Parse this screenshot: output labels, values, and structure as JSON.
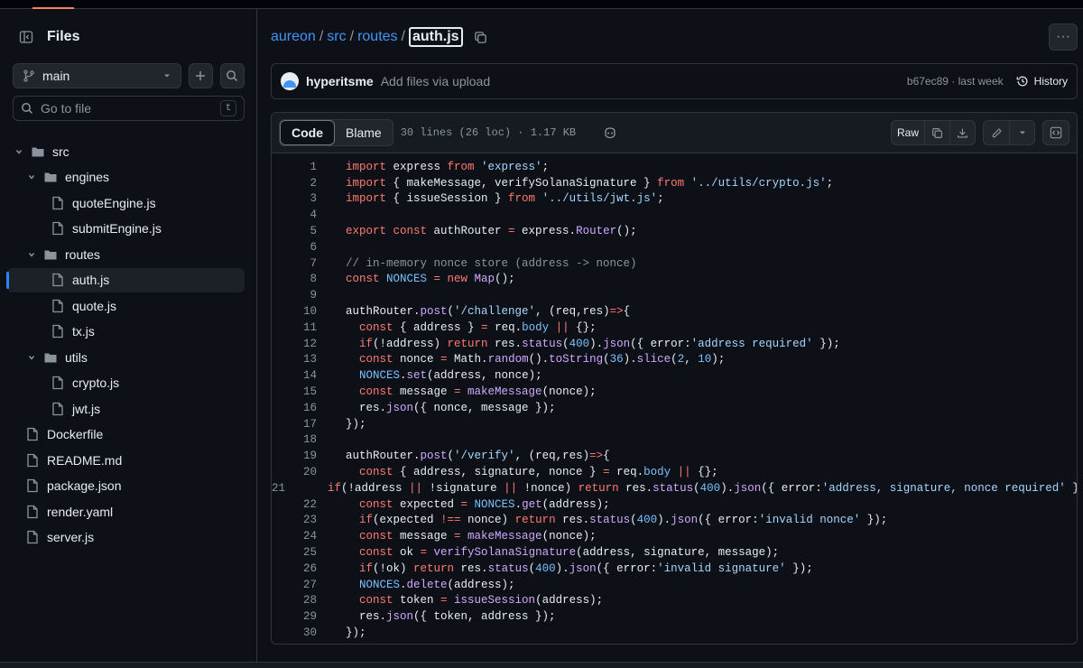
{
  "sidebar": {
    "title": "Files",
    "branch": "main",
    "search_placeholder": "Go to file",
    "search_shortcut": "t",
    "tree": [
      {
        "label": "src",
        "type": "folder",
        "depth": 0,
        "expanded": true
      },
      {
        "label": "engines",
        "type": "folder",
        "depth": 1,
        "expanded": true
      },
      {
        "label": "quoteEngine.js",
        "type": "file",
        "depth": 2
      },
      {
        "label": "submitEngine.js",
        "type": "file",
        "depth": 2
      },
      {
        "label": "routes",
        "type": "folder",
        "depth": 1,
        "expanded": true
      },
      {
        "label": "auth.js",
        "type": "file",
        "depth": 2,
        "selected": true
      },
      {
        "label": "quote.js",
        "type": "file",
        "depth": 2
      },
      {
        "label": "tx.js",
        "type": "file",
        "depth": 2
      },
      {
        "label": "utils",
        "type": "folder",
        "depth": 1,
        "expanded": true
      },
      {
        "label": "crypto.js",
        "type": "file",
        "depth": 2
      },
      {
        "label": "jwt.js",
        "type": "file",
        "depth": 2
      },
      {
        "label": "Dockerfile",
        "type": "file",
        "depth": 0
      },
      {
        "label": "README.md",
        "type": "file",
        "depth": 0
      },
      {
        "label": "package.json",
        "type": "file",
        "depth": 0
      },
      {
        "label": "render.yaml",
        "type": "file",
        "depth": 0
      },
      {
        "label": "server.js",
        "type": "file",
        "depth": 0
      }
    ]
  },
  "breadcrumb": {
    "parts": [
      "aureon",
      "src",
      "routes"
    ],
    "current": "auth.js"
  },
  "commit": {
    "user": "hyperitsme",
    "message": "Add files via upload",
    "sha_time": "b67ec89 · last week",
    "history_label": "History"
  },
  "toolbar": {
    "code_tab": "Code",
    "blame_tab": "Blame",
    "lines_info": "30 lines (26 loc) · 1.17 KB",
    "raw_label": "Raw"
  },
  "code": [
    [
      [
        "k",
        "import"
      ],
      [
        "t",
        " express "
      ],
      [
        "k",
        "from"
      ],
      [
        "s",
        " 'express'"
      ],
      [
        "t",
        ";"
      ]
    ],
    [
      [
        "k",
        "import"
      ],
      [
        "t",
        " { makeMessage, verifySolanaSignature } "
      ],
      [
        "k",
        "from"
      ],
      [
        "s",
        " '../utils/crypto.js'"
      ],
      [
        "t",
        ";"
      ]
    ],
    [
      [
        "k",
        "import"
      ],
      [
        "t",
        " { issueSession } "
      ],
      [
        "k",
        "from"
      ],
      [
        "s",
        " '../utils/jwt.js'"
      ],
      [
        "t",
        ";"
      ]
    ],
    [],
    [
      [
        "k",
        "export const"
      ],
      [
        "t",
        " authRouter "
      ],
      [
        "k",
        "="
      ],
      [
        "t",
        " express."
      ],
      [
        "f",
        "Router"
      ],
      [
        "t",
        "();"
      ]
    ],
    [],
    [
      [
        "c",
        "// in-memory nonce store (address -> nonce)"
      ]
    ],
    [
      [
        "k",
        "const"
      ],
      [
        "n",
        " NONCES"
      ],
      [
        "k",
        " = new"
      ],
      [
        "f",
        " Map"
      ],
      [
        "t",
        "();"
      ]
    ],
    [],
    [
      [
        "t",
        "authRouter."
      ],
      [
        "f",
        "post"
      ],
      [
        "t",
        "("
      ],
      [
        "s",
        "'/challenge'"
      ],
      [
        "t",
        ", (req,res)"
      ],
      [
        "k",
        "=>"
      ],
      [
        "t",
        "{"
      ]
    ],
    [
      [
        "k",
        "  const"
      ],
      [
        "t",
        " { address } "
      ],
      [
        "k",
        "="
      ],
      [
        "t",
        " req."
      ],
      [
        "n",
        "body"
      ],
      [
        "k",
        " ||"
      ],
      [
        "t",
        " {};"
      ]
    ],
    [
      [
        "k",
        "  if"
      ],
      [
        "t",
        "(!address) "
      ],
      [
        "k",
        "return"
      ],
      [
        "t",
        " res."
      ],
      [
        "f",
        "status"
      ],
      [
        "t",
        "("
      ],
      [
        "n",
        "400"
      ],
      [
        "t",
        ")."
      ],
      [
        "f",
        "json"
      ],
      [
        "t",
        "({ error:"
      ],
      [
        "s",
        "'address required'"
      ],
      [
        "t",
        " });"
      ]
    ],
    [
      [
        "k",
        "  const"
      ],
      [
        "t",
        " nonce "
      ],
      [
        "k",
        "="
      ],
      [
        "t",
        " Math."
      ],
      [
        "f",
        "random"
      ],
      [
        "t",
        "()."
      ],
      [
        "f",
        "toString"
      ],
      [
        "t",
        "("
      ],
      [
        "n",
        "36"
      ],
      [
        "t",
        ")."
      ],
      [
        "f",
        "slice"
      ],
      [
        "t",
        "("
      ],
      [
        "n",
        "2"
      ],
      [
        "t",
        ", "
      ],
      [
        "n",
        "10"
      ],
      [
        "t",
        ");"
      ]
    ],
    [
      [
        "n",
        "  NONCES"
      ],
      [
        "t",
        "."
      ],
      [
        "f",
        "set"
      ],
      [
        "t",
        "(address, nonce);"
      ]
    ],
    [
      [
        "k",
        "  const"
      ],
      [
        "t",
        " message "
      ],
      [
        "k",
        "="
      ],
      [
        "f",
        " makeMessage"
      ],
      [
        "t",
        "(nonce);"
      ]
    ],
    [
      [
        "t",
        "  res."
      ],
      [
        "f",
        "json"
      ],
      [
        "t",
        "({ nonce, message });"
      ]
    ],
    [
      [
        "t",
        "});"
      ]
    ],
    [],
    [
      [
        "t",
        "authRouter."
      ],
      [
        "f",
        "post"
      ],
      [
        "t",
        "("
      ],
      [
        "s",
        "'/verify'"
      ],
      [
        "t",
        ", (req,res)"
      ],
      [
        "k",
        "=>"
      ],
      [
        "t",
        "{"
      ]
    ],
    [
      [
        "k",
        "  const"
      ],
      [
        "t",
        " { address, signature, nonce } "
      ],
      [
        "k",
        "="
      ],
      [
        "t",
        " req."
      ],
      [
        "n",
        "body"
      ],
      [
        "k",
        " ||"
      ],
      [
        "t",
        " {};"
      ]
    ],
    [
      [
        "k",
        "  if"
      ],
      [
        "t",
        "(!address "
      ],
      [
        "k",
        "||"
      ],
      [
        "t",
        " !signature "
      ],
      [
        "k",
        "||"
      ],
      [
        "t",
        " !nonce) "
      ],
      [
        "k",
        "return"
      ],
      [
        "t",
        " res."
      ],
      [
        "f",
        "status"
      ],
      [
        "t",
        "("
      ],
      [
        "n",
        "400"
      ],
      [
        "t",
        ")."
      ],
      [
        "f",
        "json"
      ],
      [
        "t",
        "({ error:"
      ],
      [
        "s",
        "'address, signature, nonce required'"
      ],
      [
        "t",
        " });"
      ]
    ],
    [
      [
        "k",
        "  const"
      ],
      [
        "t",
        " expected "
      ],
      [
        "k",
        "="
      ],
      [
        "n",
        " NONCES"
      ],
      [
        "t",
        "."
      ],
      [
        "f",
        "get"
      ],
      [
        "t",
        "(address);"
      ]
    ],
    [
      [
        "k",
        "  if"
      ],
      [
        "t",
        "(expected "
      ],
      [
        "k",
        "!=="
      ],
      [
        "t",
        " nonce) "
      ],
      [
        "k",
        "return"
      ],
      [
        "t",
        " res."
      ],
      [
        "f",
        "status"
      ],
      [
        "t",
        "("
      ],
      [
        "n",
        "400"
      ],
      [
        "t",
        ")."
      ],
      [
        "f",
        "json"
      ],
      [
        "t",
        "({ error:"
      ],
      [
        "s",
        "'invalid nonce'"
      ],
      [
        "t",
        " });"
      ]
    ],
    [
      [
        "k",
        "  const"
      ],
      [
        "t",
        " message "
      ],
      [
        "k",
        "="
      ],
      [
        "f",
        " makeMessage"
      ],
      [
        "t",
        "(nonce);"
      ]
    ],
    [
      [
        "k",
        "  const"
      ],
      [
        "t",
        " ok "
      ],
      [
        "k",
        "="
      ],
      [
        "f",
        " verifySolanaSignature"
      ],
      [
        "t",
        "(address, signature, message);"
      ]
    ],
    [
      [
        "k",
        "  if"
      ],
      [
        "t",
        "(!ok) "
      ],
      [
        "k",
        "return"
      ],
      [
        "t",
        " res."
      ],
      [
        "f",
        "status"
      ],
      [
        "t",
        "("
      ],
      [
        "n",
        "400"
      ],
      [
        "t",
        ")."
      ],
      [
        "f",
        "json"
      ],
      [
        "t",
        "({ error:"
      ],
      [
        "s",
        "'invalid signature'"
      ],
      [
        "t",
        " });"
      ]
    ],
    [
      [
        "n",
        "  NONCES"
      ],
      [
        "t",
        "."
      ],
      [
        "f",
        "delete"
      ],
      [
        "t",
        "(address);"
      ]
    ],
    [
      [
        "k",
        "  const"
      ],
      [
        "t",
        " token "
      ],
      [
        "k",
        "="
      ],
      [
        "f",
        " issueSession"
      ],
      [
        "t",
        "(address);"
      ]
    ],
    [
      [
        "t",
        "  res."
      ],
      [
        "f",
        "json"
      ],
      [
        "t",
        "({ token, address });"
      ]
    ],
    [
      [
        "t",
        "});"
      ]
    ]
  ]
}
